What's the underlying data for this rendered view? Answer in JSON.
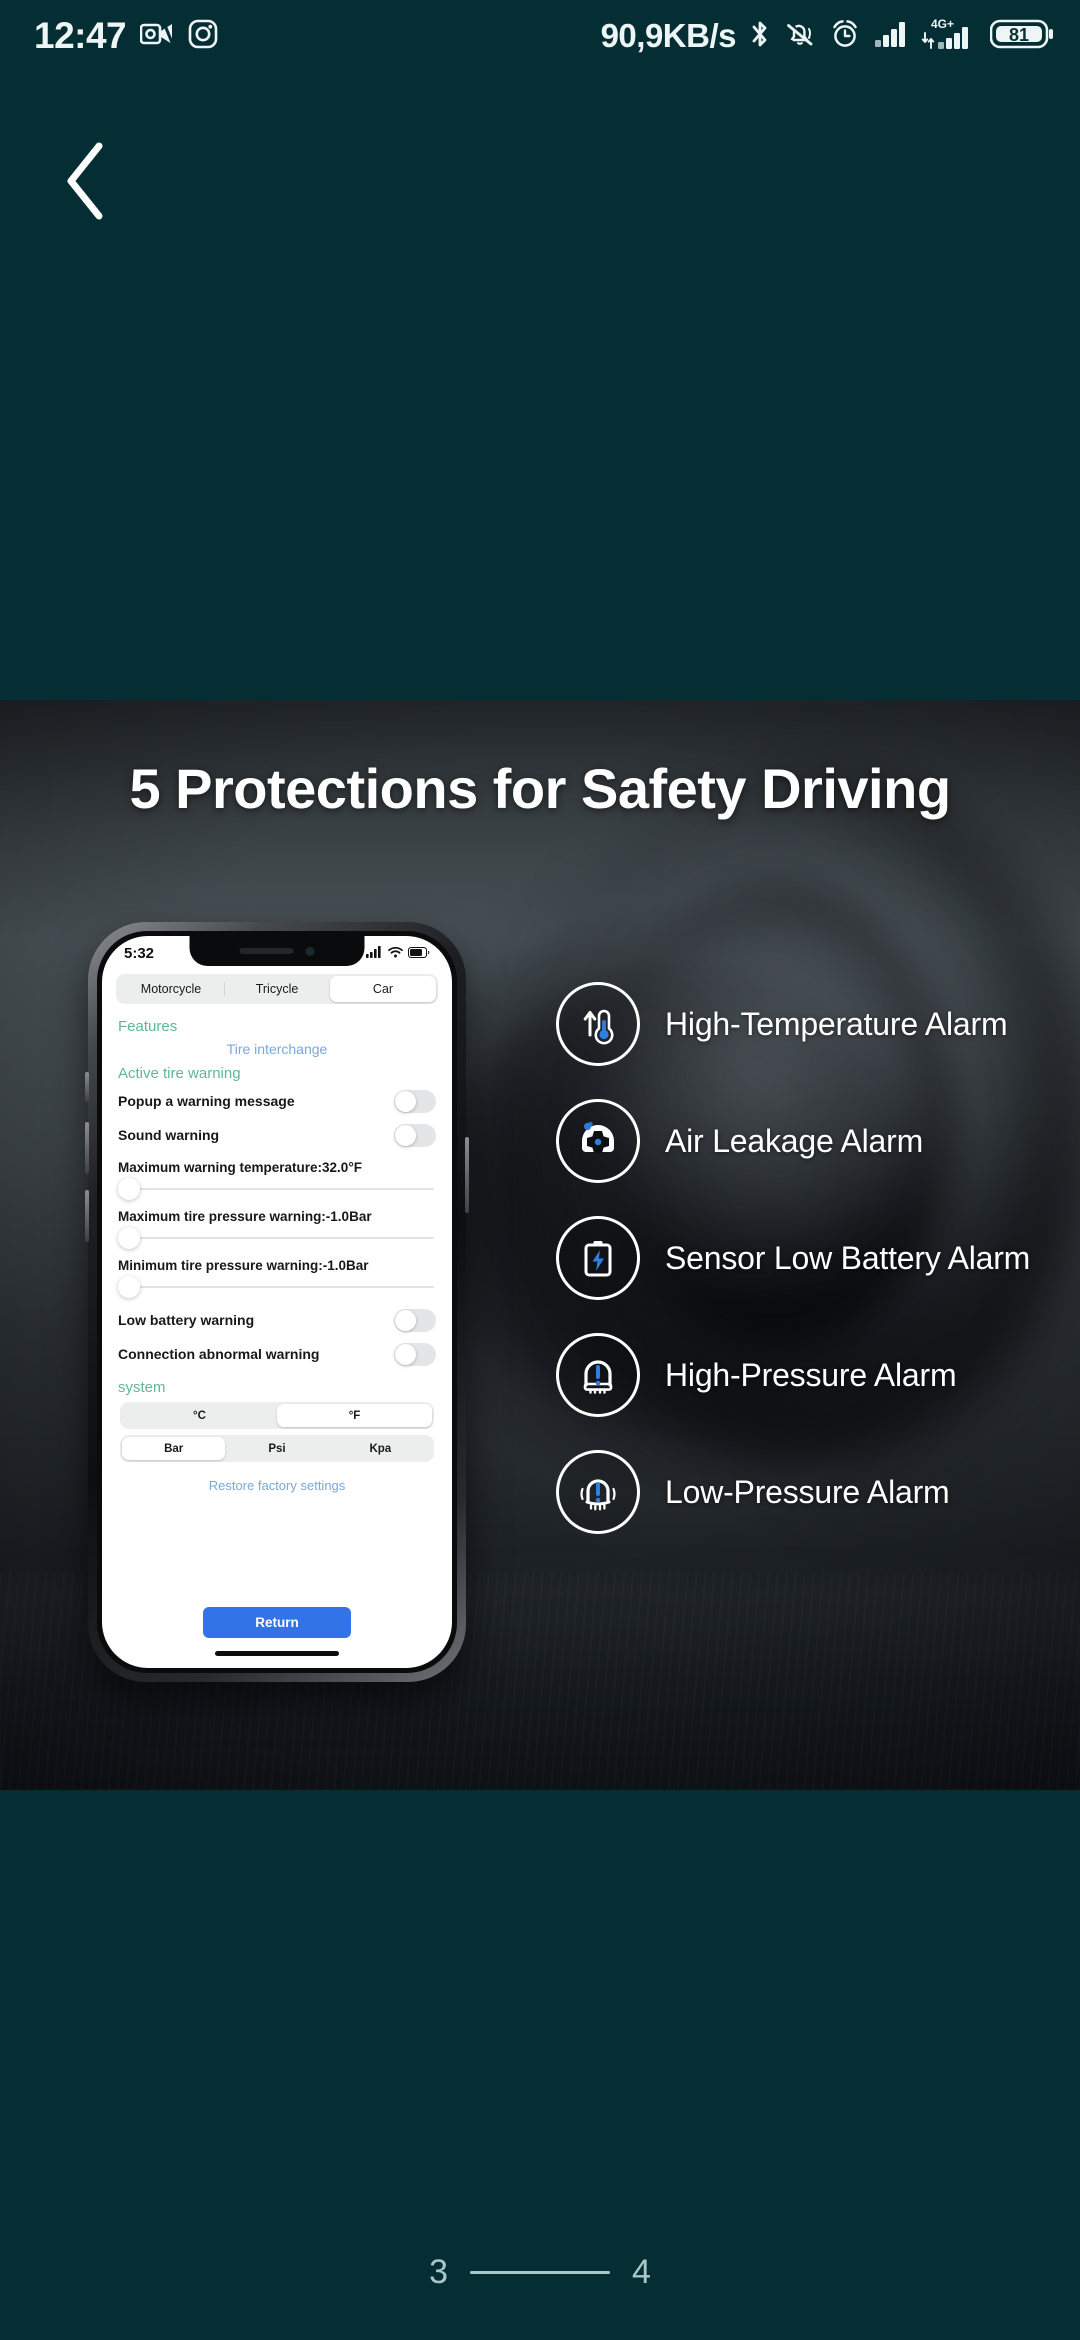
{
  "statusbar": {
    "time": "12:47",
    "network_speed": "90,9KB/s",
    "battery_level": "81",
    "mobile_network": "4G+",
    "icons": [
      "outlook-video-icon",
      "instagram-icon",
      "bluetooth-icon",
      "bell-muted-icon",
      "alarm-clock-icon",
      "signal-bars-icon",
      "signal-bars-data-icon",
      "battery-icon"
    ]
  },
  "navigation": {
    "back_label": "Back"
  },
  "banner": {
    "title": "5 Protections for Safety Driving",
    "features": [
      {
        "icon": "thermometer-up-icon",
        "label": "High-Temperature Alarm"
      },
      {
        "icon": "air-leakage-icon",
        "label": "Air Leakage Alarm"
      },
      {
        "icon": "battery-low-icon",
        "label": "Sensor Low Battery Alarm"
      },
      {
        "icon": "tire-high-pressure-icon",
        "label": "High-Pressure Alarm"
      },
      {
        "icon": "tire-low-pressure-icon",
        "label": "Low-Pressure Alarm"
      }
    ]
  },
  "phone_mockup": {
    "status": {
      "time": "5:32"
    },
    "vehicle_tabs": [
      {
        "label": "Motorcycle",
        "active": false
      },
      {
        "label": "Tricycle",
        "active": false
      },
      {
        "label": "Car",
        "active": true
      }
    ],
    "features_heading": "Features",
    "tire_interchange_link": "Tire interchange",
    "active_warning_heading": "Active tire warning",
    "toggles": [
      {
        "label": "Popup a warning message",
        "on": false
      },
      {
        "label": "Sound warning",
        "on": false
      }
    ],
    "sliders": [
      {
        "label": "Maximum warning temperature:32.0°F"
      },
      {
        "label": "Maximum tire pressure warning:-1.0Bar"
      },
      {
        "label": "Minimum tire pressure warning:-1.0Bar"
      }
    ],
    "toggles2": [
      {
        "label": "Low battery warning",
        "on": false
      },
      {
        "label": "Connection abnormal warning",
        "on": false
      }
    ],
    "system_heading": "system",
    "temp_units": [
      {
        "label": "°C",
        "active": false
      },
      {
        "label": "°F",
        "active": true
      }
    ],
    "pressure_units": [
      {
        "label": "Bar",
        "active": true
      },
      {
        "label": "Psi",
        "active": false
      },
      {
        "label": "Kpa",
        "active": false
      }
    ],
    "restore_link": "Restore factory settings",
    "return_button": "Return"
  },
  "pager": {
    "current": "3",
    "total": "4"
  },
  "colors": {
    "page_background": "#042e33",
    "accent_blue": "#3273e8",
    "icon_blue": "#2f7ee0",
    "link_blue": "#7aa8d8",
    "heading_green": "#5fb894",
    "pager": "#a8c8c8"
  }
}
